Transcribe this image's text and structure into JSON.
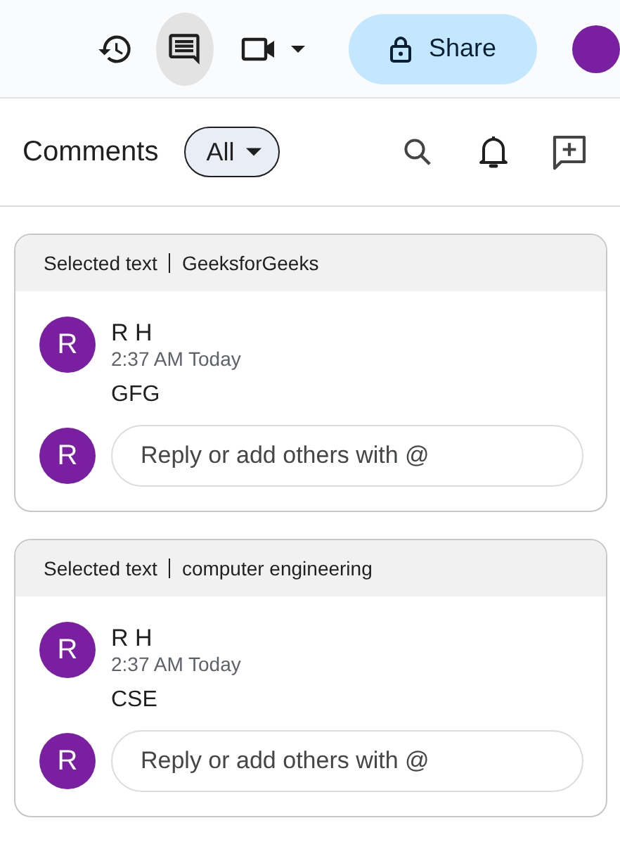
{
  "toolbar": {
    "tools": [
      {
        "kind": "history",
        "selected": false
      },
      {
        "kind": "comments",
        "selected": true
      },
      {
        "kind": "video",
        "selected": false
      }
    ],
    "share_button": {
      "label": "Share"
    }
  },
  "comments_panel": {
    "title": "Comments",
    "filter": {
      "label": "All"
    },
    "threads": [
      {
        "quote_label": "Selected text",
        "quote": "GeeksforGeeks",
        "author": "R H",
        "initial": "R",
        "time": "2:37 AM Today",
        "text": "GFG",
        "reply_initial": "R",
        "reply_placeholder": "Reply or add others with @"
      },
      {
        "quote_label": "Selected text",
        "quote": "computer engineering",
        "author": "R H",
        "initial": "R",
        "time": "2:37 AM Today",
        "text": "CSE",
        "reply_initial": "R",
        "reply_placeholder": "Reply or add others with @"
      }
    ]
  }
}
